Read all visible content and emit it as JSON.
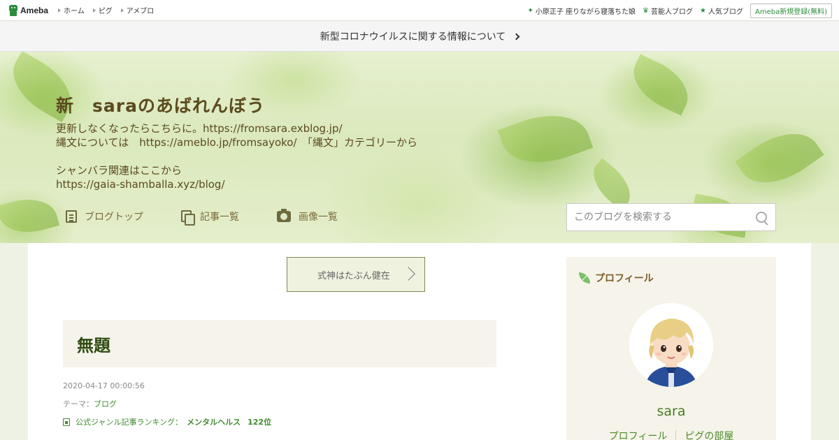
{
  "topbar": {
    "logo": "Ameba",
    "nav": [
      "ホーム",
      "ピグ",
      "アメブロ"
    ],
    "right_links": [
      {
        "icon": "sparkle-icon",
        "label": "小原正子 座りながら寝落ちた娘"
      },
      {
        "icon": "crown-icon",
        "label": "芸能人ブログ"
      },
      {
        "icon": "star-icon",
        "label": "人気ブログ"
      }
    ],
    "register": "Ameba新規登録(無料)",
    "brand_color": "#2d8c3c"
  },
  "banner": {
    "text": "新型コロナウイルスに関する情報について"
  },
  "header": {
    "title": "新　saraのあばれんぼう",
    "description": [
      "更新しなくなったらこちらに。https://fromsara.exblog.jp/",
      "縄文については　https://ameblo.jp/fromsayoko/　「縄文」カテゴリーから",
      "",
      "シャンバラ関連はここから",
      "https://gaia-shamballa.xyz/blog/"
    ],
    "nav": [
      {
        "icon": "document-icon",
        "label": "ブログトップ"
      },
      {
        "icon": "copy-icon",
        "label": "記事一覧"
      },
      {
        "icon": "camera-icon",
        "label": "画像一覧"
      }
    ],
    "search_placeholder": "このブログを検索する"
  },
  "article": {
    "prev_link": "式神はたぶん健在",
    "title": "無題",
    "date": "2020-04-17 00:00:56",
    "theme_label": "テーマ：",
    "theme": "ブログ",
    "ranking_label": "公式ジャンル記事ランキング：",
    "ranking_genre": "メンタルヘルス",
    "ranking_value": "122位"
  },
  "profile": {
    "heading": "プロフィール",
    "name": "sara",
    "links": [
      "プロフィール",
      "ピグの部屋"
    ]
  }
}
